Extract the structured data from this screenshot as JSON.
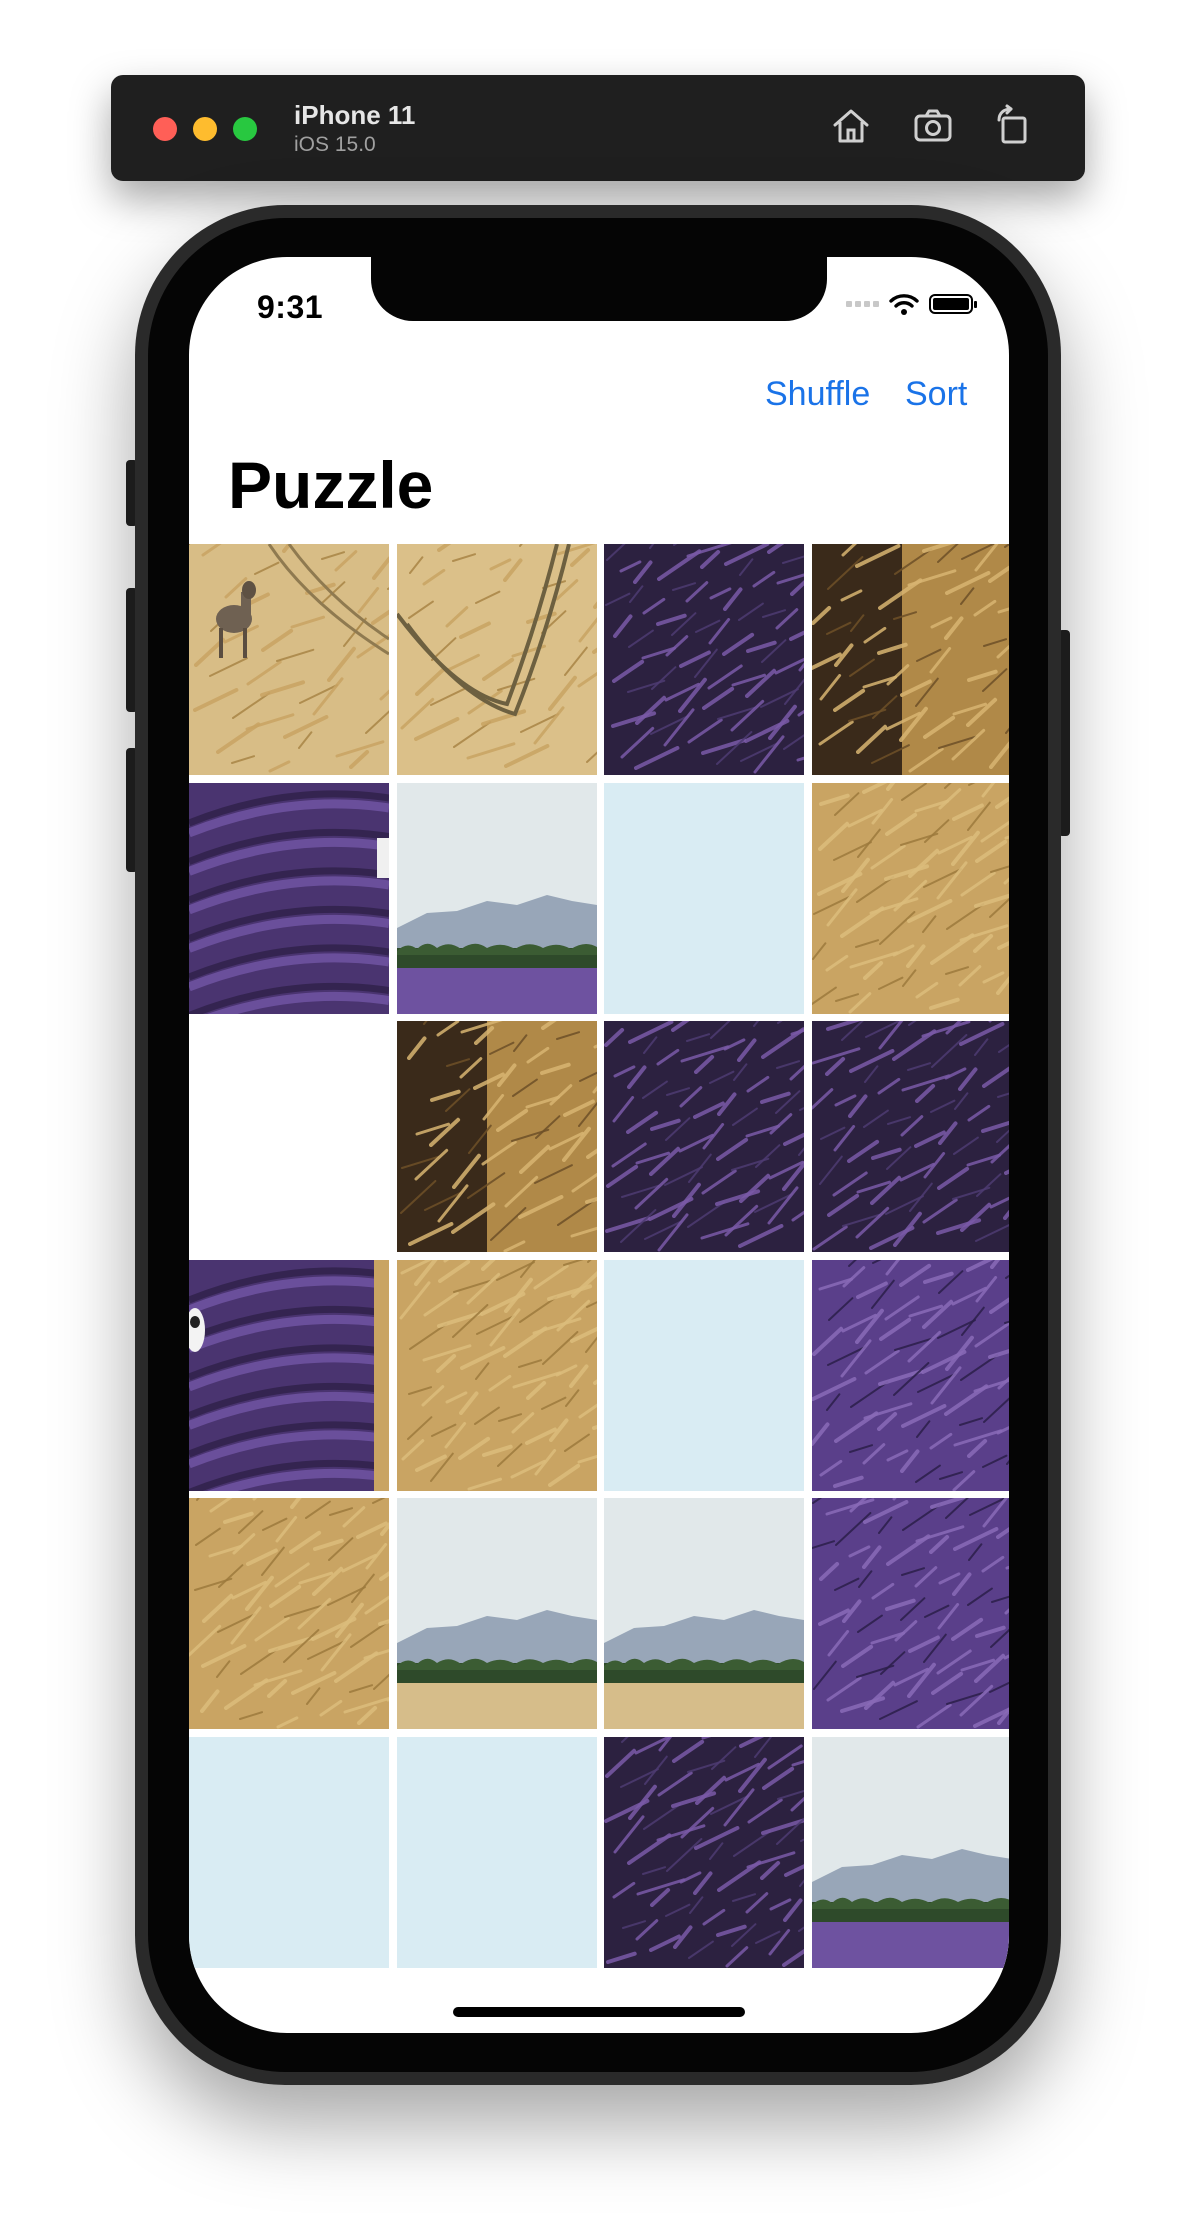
{
  "simulator": {
    "device_name": "iPhone 11",
    "os_version": "iOS 15.0",
    "icons": [
      "home-icon",
      "camera-icon",
      "rotate-icon"
    ]
  },
  "status_bar": {
    "time": "9:31",
    "icons": [
      "signal-icon",
      "wifi-icon",
      "battery-icon"
    ]
  },
  "nav": {
    "shuffle_label": "Shuffle",
    "sort_label": "Sort"
  },
  "page_title": "Puzzle",
  "puzzle": {
    "columns": 4,
    "rows": 6,
    "tiles": [
      {
        "type": "wheat-deer"
      },
      {
        "type": "wheat-tracks"
      },
      {
        "type": "lavender-dark"
      },
      {
        "type": "wheat-dark"
      },
      {
        "type": "lavender-rows-edge"
      },
      {
        "type": "sky-mountains"
      },
      {
        "type": "sky"
      },
      {
        "type": "wheat"
      },
      {
        "type": "empty"
      },
      {
        "type": "wheat-dark"
      },
      {
        "type": "lavender-dark"
      },
      {
        "type": "lavender-dark"
      },
      {
        "type": "lavender-rows-cow"
      },
      {
        "type": "wheat"
      },
      {
        "type": "sky"
      },
      {
        "type": "lavender"
      },
      {
        "type": "wheat"
      },
      {
        "type": "sky-mountains-wheat"
      },
      {
        "type": "sky-mountains-wheat"
      },
      {
        "type": "lavender"
      },
      {
        "type": "sky"
      },
      {
        "type": "sky"
      },
      {
        "type": "lavender-dark"
      },
      {
        "type": "sky-mountains-lavender"
      }
    ]
  },
  "colors": {
    "accent": "#1a73e8",
    "wheat": "#c9a463",
    "lavender": "#5a3f8a",
    "sky": "#d9ecf3"
  }
}
